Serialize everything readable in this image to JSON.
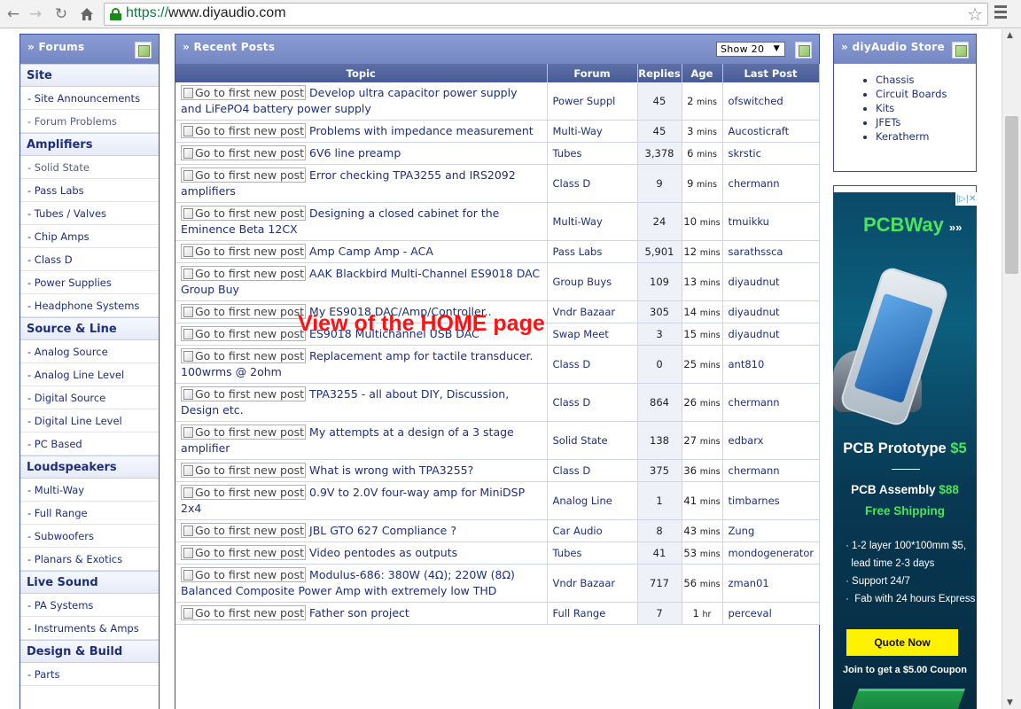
{
  "browser": {
    "url_scheme": "https://",
    "url_rest": "www.diyaudio.com",
    "back_icon": "arrow-left",
    "forward_icon": "arrow-right",
    "reload_icon": "reload",
    "home_icon": "home",
    "bookmark_icon": "star-outline",
    "menu_icon": "hamburger"
  },
  "overlay_caption": "View of the HOME page",
  "sidebar": {
    "title": "» Forums",
    "sections": [
      {
        "title": "Site",
        "links": [
          {
            "label": "- Site Announcements",
            "visited": false
          },
          {
            "label": "- Forum Problems",
            "visited": true
          }
        ]
      },
      {
        "title": "Amplifiers",
        "links": [
          {
            "label": "- Solid State",
            "visited": true
          },
          {
            "label": "- Pass Labs",
            "visited": false
          },
          {
            "label": "- Tubes / Valves",
            "visited": false
          },
          {
            "label": "- Chip Amps",
            "visited": false
          },
          {
            "label": "- Class D",
            "visited": false
          },
          {
            "label": "- Power Supplies",
            "visited": false
          },
          {
            "label": "- Headphone Systems",
            "visited": false
          }
        ]
      },
      {
        "title": "Source & Line",
        "links": [
          {
            "label": "- Analog Source",
            "visited": false
          },
          {
            "label": "- Analog Line Level",
            "visited": false
          },
          {
            "label": "- Digital Source",
            "visited": false
          },
          {
            "label": "- Digital Line Level",
            "visited": false
          },
          {
            "label": "- PC Based",
            "visited": false
          }
        ]
      },
      {
        "title": "Loudspeakers",
        "links": [
          {
            "label": "- Multi-Way",
            "visited": false
          },
          {
            "label": "- Full Range",
            "visited": false
          },
          {
            "label": "- Subwoofers",
            "visited": false
          },
          {
            "label": "- Planars & Exotics",
            "visited": false
          }
        ]
      },
      {
        "title": "Live Sound",
        "links": [
          {
            "label": "- PA Systems",
            "visited": false
          },
          {
            "label": "- Instruments & Amps",
            "visited": false
          }
        ]
      },
      {
        "title": "Design & Build",
        "links": [
          {
            "label": "- Parts",
            "visited": false
          }
        ]
      }
    ]
  },
  "recent_posts": {
    "title": "» Recent Posts",
    "show_select": "Show 20",
    "columns": [
      "Topic",
      "Forum",
      "Replies",
      "Age",
      "Last Post"
    ],
    "new_post_alt": "Go to first new post",
    "rows": [
      {
        "topic": "Develop ultra capacitor power supply and LiFePO4 battery power supply",
        "forum": "Power Suppl",
        "replies": "45",
        "age_num": "2",
        "age_unit": "mins",
        "last": "ofswitched"
      },
      {
        "topic": "Problems with impedance measurement",
        "forum": "Multi-Way",
        "replies": "45",
        "age_num": "3",
        "age_unit": "mins",
        "last": "Aucosticraft"
      },
      {
        "topic": "6V6 line preamp",
        "forum": "Tubes",
        "replies": "3,378",
        "age_num": "6",
        "age_unit": "mins",
        "last": "skrstic"
      },
      {
        "topic": "Error checking TPA3255 and IRS2092 amplifiers",
        "forum": "Class D",
        "replies": "9",
        "age_num": "9",
        "age_unit": "mins",
        "last": "chermann"
      },
      {
        "topic": "Designing a closed cabinet for the Eminence Beta 12CX",
        "forum": "Multi-Way",
        "replies": "24",
        "age_num": "10",
        "age_unit": "mins",
        "last": "tmuikku"
      },
      {
        "topic": "Amp Camp Amp - ACA",
        "forum": "Pass Labs",
        "replies": "5,901",
        "age_num": "12",
        "age_unit": "mins",
        "last": "sarathssca"
      },
      {
        "topic": "AAK Blackbird Multi-Channel ES9018 DAC Group Buy",
        "forum": "Group Buys",
        "replies": "109",
        "age_num": "13",
        "age_unit": "mins",
        "last": "diyaudnut"
      },
      {
        "topic": "My ES9018 DAC/Amp/Controller..",
        "forum": "Vndr Bazaar",
        "replies": "305",
        "age_num": "14",
        "age_unit": "mins",
        "last": "diyaudnut"
      },
      {
        "topic": "ES9018 Multichannel USB DAC",
        "forum": "Swap Meet",
        "replies": "3",
        "age_num": "15",
        "age_unit": "mins",
        "last": "diyaudnut"
      },
      {
        "topic": "Replacement amp for tactile transducer. 100wrms @ 2ohm",
        "forum": "Class D",
        "replies": "0",
        "age_num": "25",
        "age_unit": "mins",
        "last": "ant810"
      },
      {
        "topic": "TPA3255 - all about DIY, Discussion, Design etc.",
        "forum": "Class D",
        "replies": "864",
        "age_num": "26",
        "age_unit": "mins",
        "last": "chermann"
      },
      {
        "topic": "My attempts at a design of a 3 stage amplifier",
        "forum": "Solid State",
        "replies": "138",
        "age_num": "27",
        "age_unit": "mins",
        "last": "edbarx"
      },
      {
        "topic": "What is wrong with TPA3255?",
        "forum": "Class D",
        "replies": "375",
        "age_num": "36",
        "age_unit": "mins",
        "last": "chermann"
      },
      {
        "topic": "0.9V to 2.0V four-way amp for MiniDSP 2x4",
        "forum": "Analog Line",
        "replies": "1",
        "age_num": "41",
        "age_unit": "mins",
        "last": "timbarnes"
      },
      {
        "topic": "JBL GTO 627 Compliance ?",
        "forum": "Car Audio",
        "replies": "8",
        "age_num": "43",
        "age_unit": "mins",
        "last": "Zung"
      },
      {
        "topic": "Video pentodes as outputs",
        "forum": "Tubes",
        "replies": "41",
        "age_num": "53",
        "age_unit": "mins",
        "last": "mondogenerator"
      },
      {
        "topic": "Modulus-686: 380W (4Ω); 220W (8Ω) Balanced Composite Power Amp with extremely low THD",
        "forum": "Vndr Bazaar",
        "replies": "717",
        "age_num": "56",
        "age_unit": "mins",
        "last": "zman01"
      },
      {
        "topic": "Father son project",
        "forum": "Full Range",
        "replies": "7",
        "age_num": "1",
        "age_unit": "hr",
        "last": "perceval"
      }
    ]
  },
  "store": {
    "title": "» diyAudio Store",
    "items": [
      "Chassis",
      "Circuit Boards",
      "Kits",
      "JFETs",
      "Keratherm"
    ]
  },
  "ad": {
    "brand": "PCBWay",
    "brand_chevrons": "»»",
    "adchoices": "|▷|✕",
    "headline": "PCB Prototype",
    "headline_price": "$5",
    "assembly": "PCB Assembly",
    "assembly_price": "$88",
    "shipping": "Free Shipping",
    "bullets": [
      "· 1-2 layer 100*100mm $5,",
      "  lead time 2-3 days",
      "· Support 24/7",
      "·  Fab with 24 hours Express"
    ],
    "cta": "Quote Now",
    "coupon": "Join to get a $5.00 Coupon"
  }
}
